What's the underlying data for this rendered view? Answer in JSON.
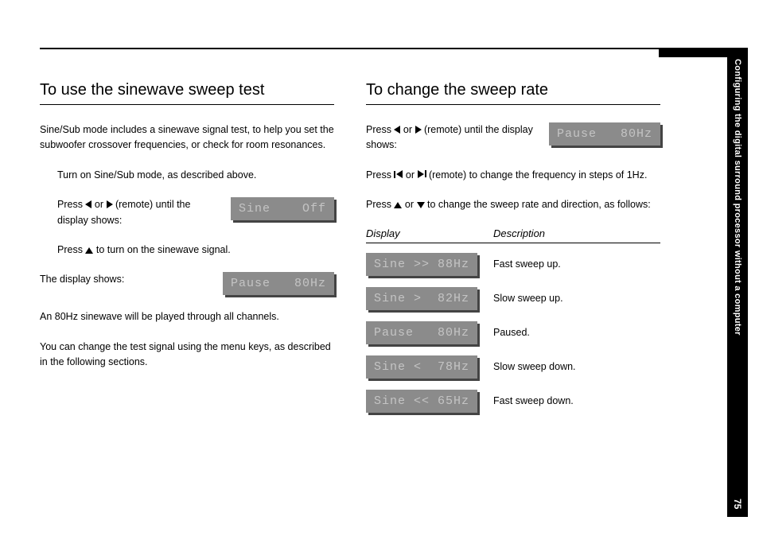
{
  "sidebar": {
    "section_label": "Configuring the digital surround processor without a computer",
    "page_number": "75"
  },
  "left": {
    "heading": "To use the sinewave sweep test",
    "intro": "Sine/Sub mode includes a sinewave signal test, to help you set the subwoofer crossover frequencies, or check for room resonances.",
    "step1": "Turn on Sine/Sub mode, as described above.",
    "step2_pre": "Press ",
    "step2_mid": " or ",
    "step2_post": " (remote) until the display shows:",
    "lcd1": "Sine    Off",
    "step3_pre": "Press ",
    "step3_post": " to turn on the sinewave signal.",
    "shows": "The display shows:",
    "lcd2": "Pause   80Hz",
    "p4": "An 80Hz sinewave will be played through all channels.",
    "p5": "You can change the test signal using the menu keys, as described in the following sections."
  },
  "right": {
    "heading": "To change the sweep rate",
    "step1_pre": "Press ",
    "step1_mid": " or ",
    "step1_post": " (remote) until the display shows:",
    "lcd1": "Pause   80Hz",
    "step2_pre": "Press ",
    "step2_mid": " or ",
    "step2_post": " (remote) to change the frequency in steps of 1Hz.",
    "step3_pre": "Press ",
    "step3_mid": " or ",
    "step3_post": " to change the sweep rate and direction, as follows:",
    "table": {
      "head_display": "Display",
      "head_desc": "Description",
      "rows": [
        {
          "lcd": "Sine >> 88Hz",
          "desc": "Fast sweep up."
        },
        {
          "lcd": "Sine >  82Hz",
          "desc": "Slow sweep up."
        },
        {
          "lcd": "Pause   80Hz",
          "desc": "Paused."
        },
        {
          "lcd": "Sine <  78Hz",
          "desc": "Slow sweep down."
        },
        {
          "lcd": "Sine << 65Hz",
          "desc": "Fast sweep down."
        }
      ]
    }
  }
}
